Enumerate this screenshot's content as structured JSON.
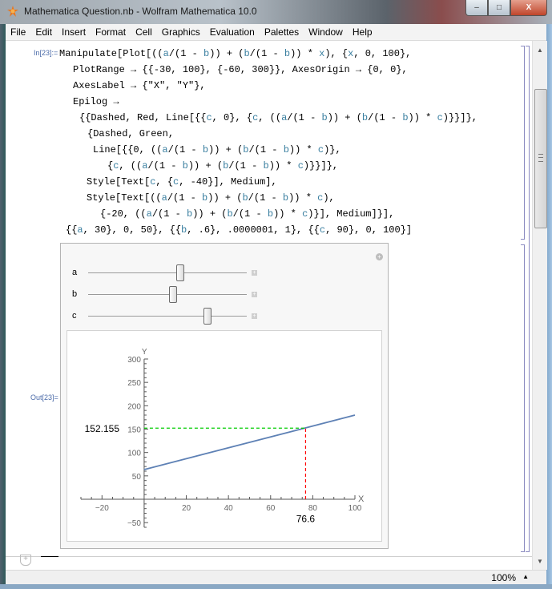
{
  "window": {
    "title": "Mathematica Question.nb - Wolfram Mathematica 10.0",
    "icon": "mathematica-spikey-icon",
    "buttons": {
      "minimize": "–",
      "maximize": "□",
      "close": "X"
    }
  },
  "menu": [
    "File",
    "Edit",
    "Insert",
    "Format",
    "Cell",
    "Graphics",
    "Evaluation",
    "Palettes",
    "Window",
    "Help"
  ],
  "notebook": {
    "input_label": "In[23]:=",
    "output_label": "Out[23]=",
    "code_lines": [
      "Manipulate[Plot[((a/(1 - b)) + (b/(1 - b)) * x), {x, 0, 100},",
      "   PlotRange → {{-30, 100}, {-60, 300}}, AxesOrigin → {0, 0},",
      "   AxesLabel → {\"X\", \"Y\"},",
      "   Epilog →",
      "    {{Dashed, Red, Line[{{c, 0}, {c, ((a/(1 - b)) + (b/(1 - b)) * c)}}]},",
      "     {Dashed, Green,",
      "      Line[{{0, ((a/(1 - b)) + (b/(1 - b)) * c)},",
      "         {c, ((a/(1 - b)) + (b/(1 - b)) * c)}}]},",
      "     Style[Text[c, {c, -40}], Medium],",
      "     Style[Text[((a/(1 - b)) + (b/(1 - b)) * c),",
      "       {-20, ((a/(1 - b)) + (b/(1 - b)) * c)}], Medium]}],",
      "  {{a, 30}, 0, 50}, {{b, .6}, .0000001, 1}, {{c, 90}, 0, 100}]"
    ]
  },
  "manipulate": {
    "sliders": [
      {
        "label": "a",
        "min": 0,
        "max": 50,
        "value": 29.3
      },
      {
        "label": "b",
        "min": 1e-07,
        "max": 1,
        "value": 0.538
      },
      {
        "label": "c",
        "min": 0,
        "max": 100,
        "value": 76.6
      }
    ],
    "plus_icon": "+",
    "options_icon": "+"
  },
  "chart_data": {
    "type": "line",
    "title": "",
    "xlabel": "X",
    "ylabel": "Y",
    "xlim": [
      -30,
      100
    ],
    "ylim": [
      -60,
      300
    ],
    "x_ticks": [
      -20,
      20,
      40,
      60,
      80,
      100
    ],
    "y_ticks": [
      -50,
      50,
      100,
      150,
      200,
      250,
      300
    ],
    "x_tick_labels": [
      "−20",
      "20",
      "40",
      "60",
      "80",
      "100"
    ],
    "y_tick_labels": [
      "−50",
      "50",
      "100",
      "150",
      "200",
      "250",
      "300"
    ],
    "series": [
      {
        "name": "a/(1-b) + b/(1-b)*x",
        "color": "#5e81b5",
        "x": [
          0,
          100
        ],
        "y": [
          63.4,
          180.0
        ]
      }
    ],
    "epilog": {
      "red_dashed": {
        "color": "#ff0000",
        "x": [
          76.6,
          76.6
        ],
        "y": [
          0,
          152.155
        ]
      },
      "green_dashed": {
        "color": "#00cc00",
        "x": [
          0,
          76.6
        ],
        "y": [
          152.155,
          152.155
        ]
      },
      "c_label": {
        "text": "76.6",
        "x": 76.6,
        "y": -40
      },
      "y_label": {
        "text": "152.155",
        "x": -20,
        "y": 152.155
      }
    },
    "grid": false
  },
  "status": {
    "zoom": "100%"
  }
}
